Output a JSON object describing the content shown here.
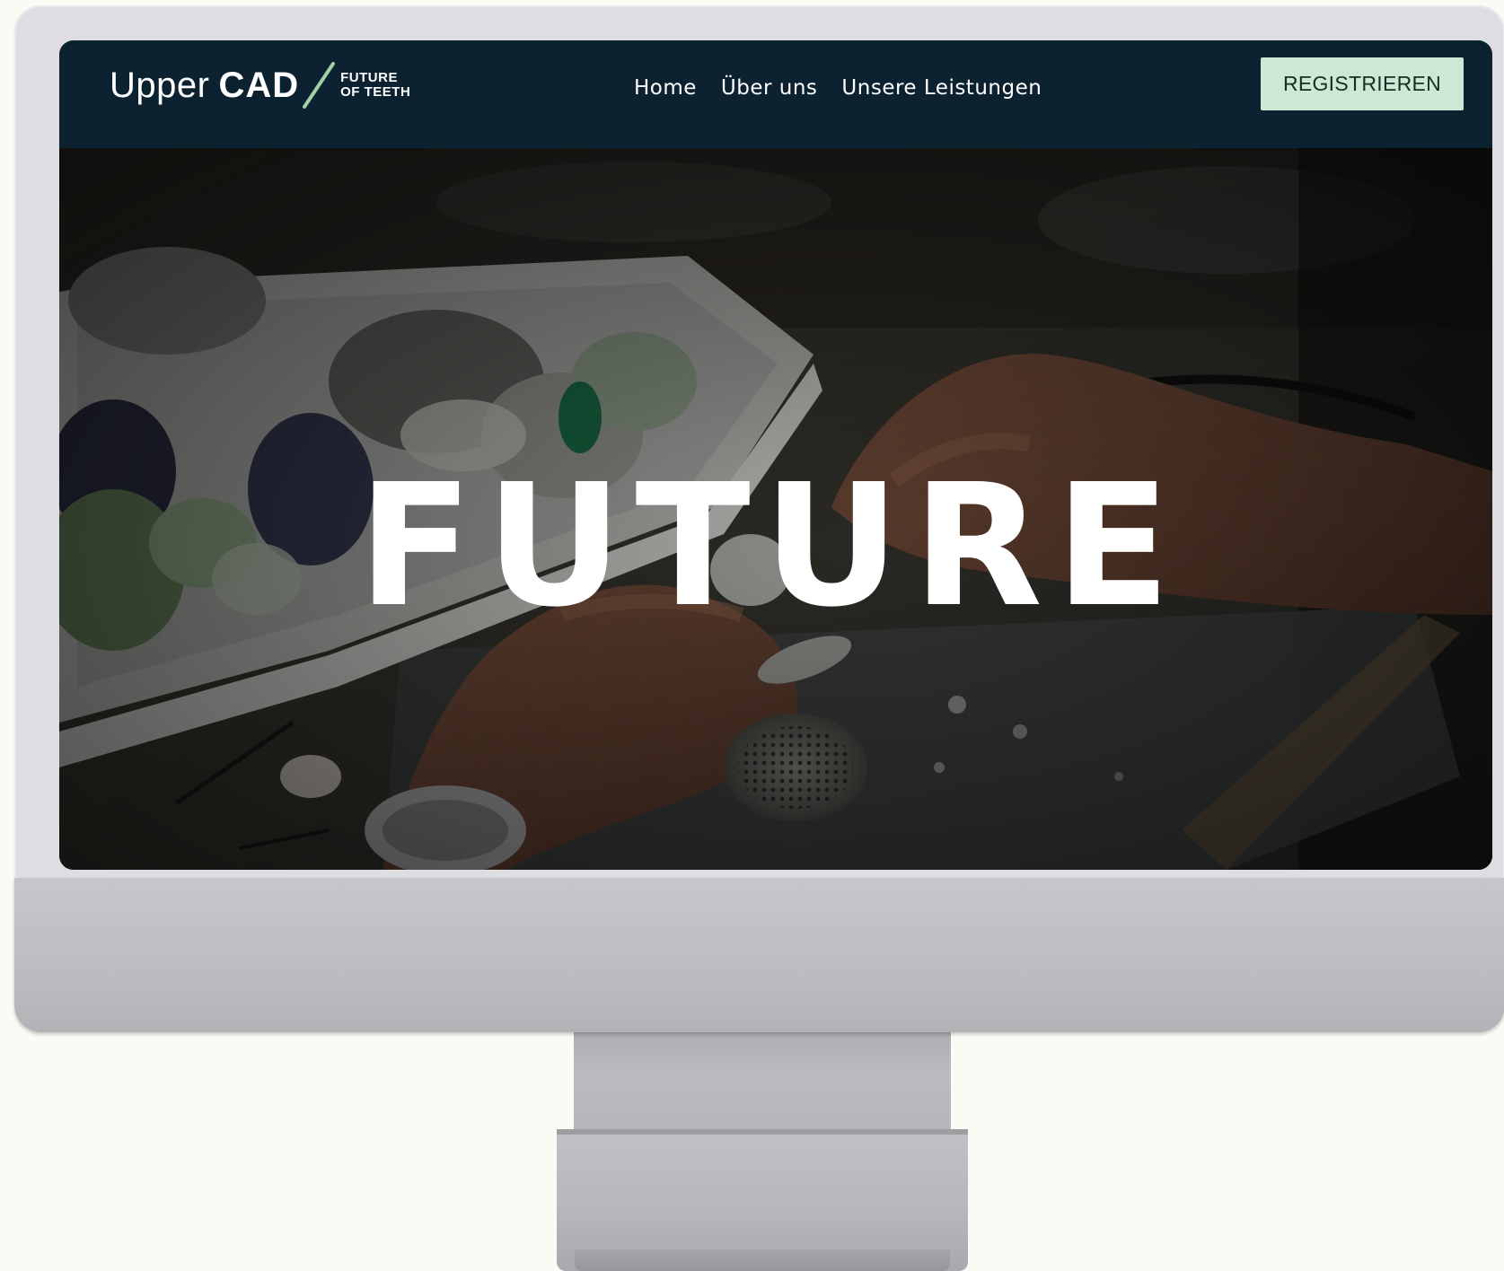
{
  "logo": {
    "upper": "Upper",
    "cad": "CAD",
    "tagline_line1": "FUTURE",
    "tagline_line2": "OF TEETH"
  },
  "nav": {
    "items": [
      {
        "label": "Home"
      },
      {
        "label": "Über uns"
      },
      {
        "label": "Unsere Leistungen"
      }
    ]
  },
  "header": {
    "register_label": "REGISTRIEREN"
  },
  "hero": {
    "title": "FUTURE"
  },
  "colors": {
    "navbar_bg": "#0d2230",
    "register_bg": "#cde8d4",
    "logo_slash": "#9fd1a8",
    "page_bg": "#fbfbf6",
    "monitor_silver": "#dedde2"
  },
  "icons": {
    "logo_divider": "slash-icon"
  }
}
